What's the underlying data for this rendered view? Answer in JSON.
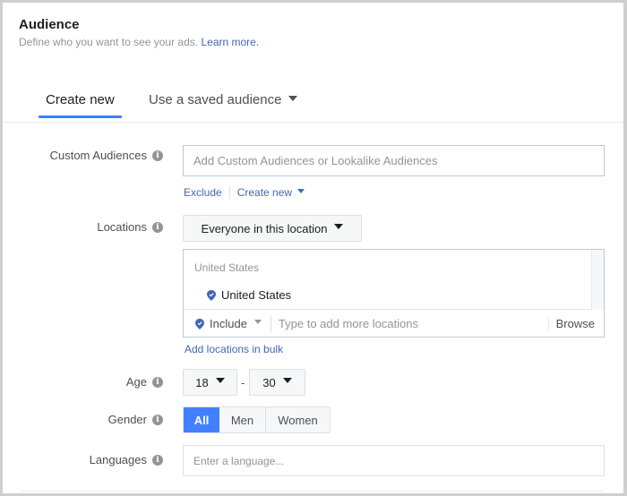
{
  "header": {
    "title": "Audience",
    "subtitle": "Define who you want to see your ads.",
    "learn_more": "Learn more."
  },
  "tabs": [
    {
      "label": "Create new",
      "active": true
    },
    {
      "label": "Use a saved audience",
      "active": false
    }
  ],
  "custom_audiences": {
    "label": "Custom Audiences",
    "placeholder": "Add Custom Audiences or Lookalike Audiences",
    "exclude_label": "Exclude",
    "create_new_label": "Create new"
  },
  "locations": {
    "label": "Locations",
    "scope_dropdown": "Everyone in this location",
    "group_header": "United States",
    "selected": [
      "United States"
    ],
    "include_label": "Include",
    "input_placeholder": "Type to add more locations",
    "browse_label": "Browse",
    "bulk_link": "Add locations in bulk"
  },
  "age": {
    "label": "Age",
    "min": "18",
    "max": "30",
    "separator": "-"
  },
  "gender": {
    "label": "Gender",
    "options": [
      "All",
      "Men",
      "Women"
    ],
    "selected": "All"
  },
  "languages": {
    "label": "Languages",
    "placeholder": "Enter a language..."
  },
  "colors": {
    "accent": "#4080ff",
    "link": "#4267b2",
    "muted_text": "#90949c"
  }
}
